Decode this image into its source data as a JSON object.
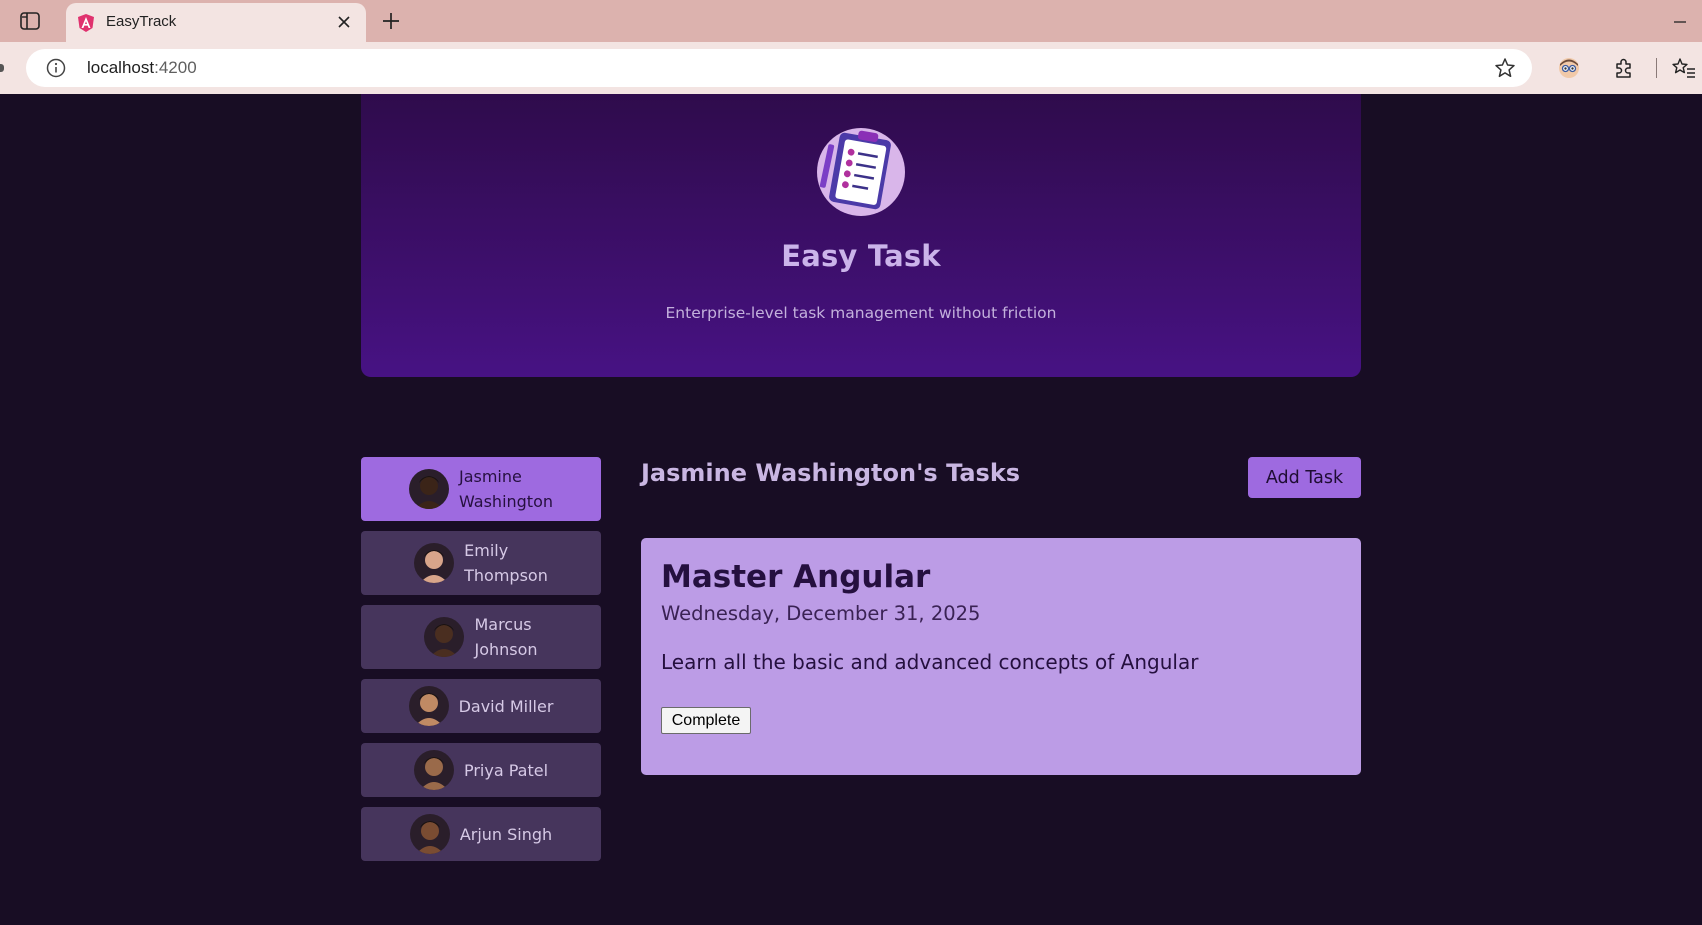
{
  "browser": {
    "tab_title": "EasyTrack",
    "url_host": "localhost",
    "url_port": ":4200",
    "icons": [
      "sidebar-toggle-icon",
      "angular-favicon-icon",
      "close-icon",
      "plus-icon",
      "minimize-icon",
      "info-icon",
      "star-icon",
      "profile-icon",
      "extensions-icon",
      "favorites-icon"
    ]
  },
  "header": {
    "logo_icon": "clipboard-task-list-icon",
    "title": "Easy Task",
    "subtitle": "Enterprise-level task management without friction"
  },
  "users": [
    {
      "name_line1": "Jasmine",
      "name_line2": "Washington",
      "active": true,
      "skin": "#3b2418"
    },
    {
      "name_line1": "Emily",
      "name_line2": "Thompson",
      "active": false,
      "skin": "#d8a58a"
    },
    {
      "name_line1": "Marcus",
      "name_line2": "Johnson",
      "active": false,
      "skin": "#4a2e20"
    },
    {
      "name_line1": "David Miller",
      "name_line2": "",
      "active": false,
      "skin": "#c08a64"
    },
    {
      "name_line1": "Priya Patel",
      "name_line2": "",
      "active": false,
      "skin": "#9a6a4a"
    },
    {
      "name_line1": "Arjun Singh",
      "name_line2": "",
      "active": false,
      "skin": "#7a4c32"
    }
  ],
  "tasks_panel": {
    "title": "Jasmine Washington's Tasks",
    "add_task_label": "Add Task"
  },
  "task": {
    "title": "Master Angular",
    "date": "Wednesday, December 31, 2025",
    "description": "Learn all the basic and advanced concepts of Angular",
    "complete_label": "Complete"
  },
  "colors": {
    "page_bg": "#180d24",
    "accent": "#9e6ae0",
    "card_bg": "#bc9ce6",
    "user_item_bg": "#46355c"
  }
}
